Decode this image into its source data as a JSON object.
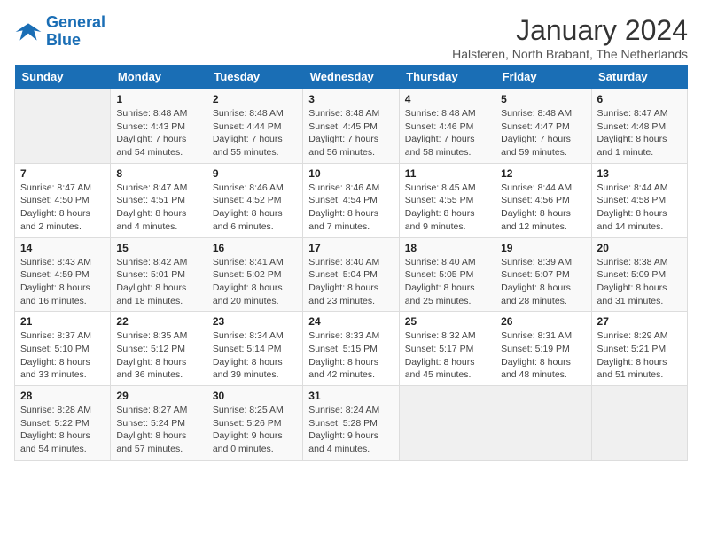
{
  "header": {
    "logo_line1": "General",
    "logo_line2": "Blue",
    "title": "January 2024",
    "subtitle": "Halsteren, North Brabant, The Netherlands"
  },
  "days_of_week": [
    "Sunday",
    "Monday",
    "Tuesday",
    "Wednesday",
    "Thursday",
    "Friday",
    "Saturday"
  ],
  "weeks": [
    [
      {
        "day": "",
        "info": ""
      },
      {
        "day": "1",
        "info": "Sunrise: 8:48 AM\nSunset: 4:43 PM\nDaylight: 7 hours\nand 54 minutes."
      },
      {
        "day": "2",
        "info": "Sunrise: 8:48 AM\nSunset: 4:44 PM\nDaylight: 7 hours\nand 55 minutes."
      },
      {
        "day": "3",
        "info": "Sunrise: 8:48 AM\nSunset: 4:45 PM\nDaylight: 7 hours\nand 56 minutes."
      },
      {
        "day": "4",
        "info": "Sunrise: 8:48 AM\nSunset: 4:46 PM\nDaylight: 7 hours\nand 58 minutes."
      },
      {
        "day": "5",
        "info": "Sunrise: 8:48 AM\nSunset: 4:47 PM\nDaylight: 7 hours\nand 59 minutes."
      },
      {
        "day": "6",
        "info": "Sunrise: 8:47 AM\nSunset: 4:48 PM\nDaylight: 8 hours\nand 1 minute."
      }
    ],
    [
      {
        "day": "7",
        "info": "Sunrise: 8:47 AM\nSunset: 4:50 PM\nDaylight: 8 hours\nand 2 minutes."
      },
      {
        "day": "8",
        "info": "Sunrise: 8:47 AM\nSunset: 4:51 PM\nDaylight: 8 hours\nand 4 minutes."
      },
      {
        "day": "9",
        "info": "Sunrise: 8:46 AM\nSunset: 4:52 PM\nDaylight: 8 hours\nand 6 minutes."
      },
      {
        "day": "10",
        "info": "Sunrise: 8:46 AM\nSunset: 4:54 PM\nDaylight: 8 hours\nand 7 minutes."
      },
      {
        "day": "11",
        "info": "Sunrise: 8:45 AM\nSunset: 4:55 PM\nDaylight: 8 hours\nand 9 minutes."
      },
      {
        "day": "12",
        "info": "Sunrise: 8:44 AM\nSunset: 4:56 PM\nDaylight: 8 hours\nand 12 minutes."
      },
      {
        "day": "13",
        "info": "Sunrise: 8:44 AM\nSunset: 4:58 PM\nDaylight: 8 hours\nand 14 minutes."
      }
    ],
    [
      {
        "day": "14",
        "info": "Sunrise: 8:43 AM\nSunset: 4:59 PM\nDaylight: 8 hours\nand 16 minutes."
      },
      {
        "day": "15",
        "info": "Sunrise: 8:42 AM\nSunset: 5:01 PM\nDaylight: 8 hours\nand 18 minutes."
      },
      {
        "day": "16",
        "info": "Sunrise: 8:41 AM\nSunset: 5:02 PM\nDaylight: 8 hours\nand 20 minutes."
      },
      {
        "day": "17",
        "info": "Sunrise: 8:40 AM\nSunset: 5:04 PM\nDaylight: 8 hours\nand 23 minutes."
      },
      {
        "day": "18",
        "info": "Sunrise: 8:40 AM\nSunset: 5:05 PM\nDaylight: 8 hours\nand 25 minutes."
      },
      {
        "day": "19",
        "info": "Sunrise: 8:39 AM\nSunset: 5:07 PM\nDaylight: 8 hours\nand 28 minutes."
      },
      {
        "day": "20",
        "info": "Sunrise: 8:38 AM\nSunset: 5:09 PM\nDaylight: 8 hours\nand 31 minutes."
      }
    ],
    [
      {
        "day": "21",
        "info": "Sunrise: 8:37 AM\nSunset: 5:10 PM\nDaylight: 8 hours\nand 33 minutes."
      },
      {
        "day": "22",
        "info": "Sunrise: 8:35 AM\nSunset: 5:12 PM\nDaylight: 8 hours\nand 36 minutes."
      },
      {
        "day": "23",
        "info": "Sunrise: 8:34 AM\nSunset: 5:14 PM\nDaylight: 8 hours\nand 39 minutes."
      },
      {
        "day": "24",
        "info": "Sunrise: 8:33 AM\nSunset: 5:15 PM\nDaylight: 8 hours\nand 42 minutes."
      },
      {
        "day": "25",
        "info": "Sunrise: 8:32 AM\nSunset: 5:17 PM\nDaylight: 8 hours\nand 45 minutes."
      },
      {
        "day": "26",
        "info": "Sunrise: 8:31 AM\nSunset: 5:19 PM\nDaylight: 8 hours\nand 48 minutes."
      },
      {
        "day": "27",
        "info": "Sunrise: 8:29 AM\nSunset: 5:21 PM\nDaylight: 8 hours\nand 51 minutes."
      }
    ],
    [
      {
        "day": "28",
        "info": "Sunrise: 8:28 AM\nSunset: 5:22 PM\nDaylight: 8 hours\nand 54 minutes."
      },
      {
        "day": "29",
        "info": "Sunrise: 8:27 AM\nSunset: 5:24 PM\nDaylight: 8 hours\nand 57 minutes."
      },
      {
        "day": "30",
        "info": "Sunrise: 8:25 AM\nSunset: 5:26 PM\nDaylight: 9 hours\nand 0 minutes."
      },
      {
        "day": "31",
        "info": "Sunrise: 8:24 AM\nSunset: 5:28 PM\nDaylight: 9 hours\nand 4 minutes."
      },
      {
        "day": "",
        "info": ""
      },
      {
        "day": "",
        "info": ""
      },
      {
        "day": "",
        "info": ""
      }
    ]
  ]
}
